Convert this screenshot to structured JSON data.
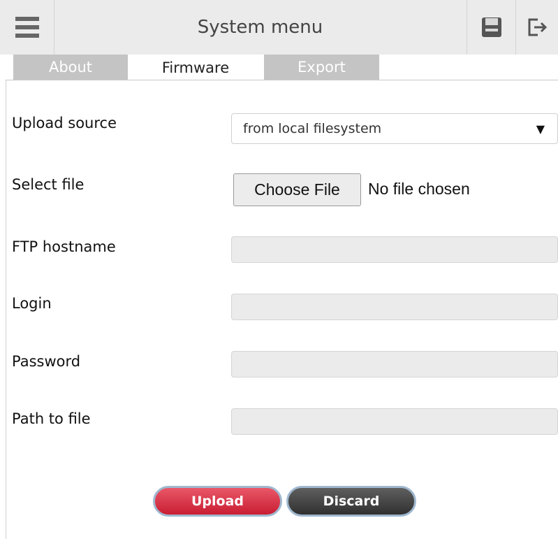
{
  "header": {
    "title": "System menu",
    "menu_icon": "hamburger-icon",
    "save_icon": "floppy-disk-icon",
    "logout_icon": "logout-icon"
  },
  "tabs": [
    {
      "label": "About",
      "active": false
    },
    {
      "label": "Firmware",
      "active": true
    },
    {
      "label": "Export",
      "active": false
    }
  ],
  "form": {
    "upload_source": {
      "label": "Upload source",
      "value": "from local filesystem"
    },
    "select_file": {
      "label": "Select file",
      "button": "Choose File",
      "status": "No file chosen"
    },
    "ftp_hostname": {
      "label": "FTP hostname",
      "value": ""
    },
    "login": {
      "label": "Login",
      "value": ""
    },
    "password": {
      "label": "Password",
      "value": ""
    },
    "path_to_file": {
      "label": "Path to file",
      "value": ""
    }
  },
  "actions": {
    "upload": "Upload",
    "discard": "Discard"
  },
  "colors": {
    "upload_button": "#d42a3d",
    "discard_button": "#3f3f3f",
    "header_background": "#ebebeb",
    "inactive_tab": "#c4c4c4"
  }
}
